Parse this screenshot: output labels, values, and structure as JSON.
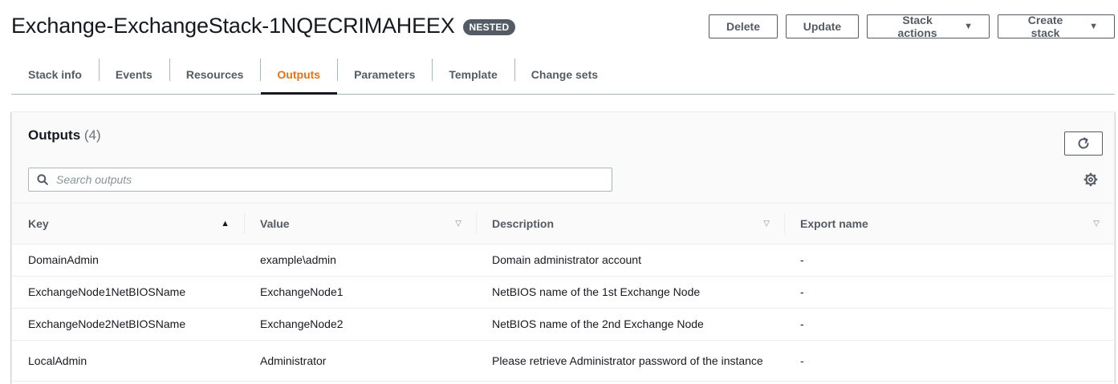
{
  "header": {
    "title": "Exchange-ExchangeStack-1NQECRIMAHEEX",
    "badge": "NESTED",
    "buttons": {
      "delete": "Delete",
      "update": "Update",
      "stack_actions": "Stack actions",
      "create_stack": "Create stack"
    }
  },
  "tabs": [
    {
      "label": "Stack info"
    },
    {
      "label": "Events"
    },
    {
      "label": "Resources"
    },
    {
      "label": "Outputs",
      "active": true
    },
    {
      "label": "Parameters"
    },
    {
      "label": "Template"
    },
    {
      "label": "Change sets"
    }
  ],
  "outputs": {
    "title": "Outputs",
    "count": "(4)",
    "search_placeholder": "Search outputs",
    "columns": [
      "Key",
      "Value",
      "Description",
      "Export name"
    ],
    "rows": [
      {
        "key": "DomainAdmin",
        "value": "example\\admin",
        "description": "Domain administrator account",
        "export": "-"
      },
      {
        "key": "ExchangeNode1NetBIOSName",
        "value": "ExchangeNode1",
        "description": "NetBIOS name of the 1st Exchange Node",
        "export": "-"
      },
      {
        "key": "ExchangeNode2NetBIOSName",
        "value": "ExchangeNode2",
        "description": "NetBIOS name of the 2nd Exchange Node",
        "export": "-"
      },
      {
        "key": "LocalAdmin",
        "value": "Administrator",
        "description": "Please retrieve Administrator password of the instance",
        "export": "-"
      }
    ]
  },
  "colors": {
    "accent": "#ec7211",
    "text": "#16191f",
    "muted": "#545b64",
    "badge": "#545b64"
  },
  "icons": {
    "search": "search-icon",
    "refresh": "refresh-icon",
    "settings": "gear-icon",
    "caret": "caret-down-icon",
    "sort_asc": "sort-ascending-icon",
    "sort_none": "sort-icon"
  }
}
